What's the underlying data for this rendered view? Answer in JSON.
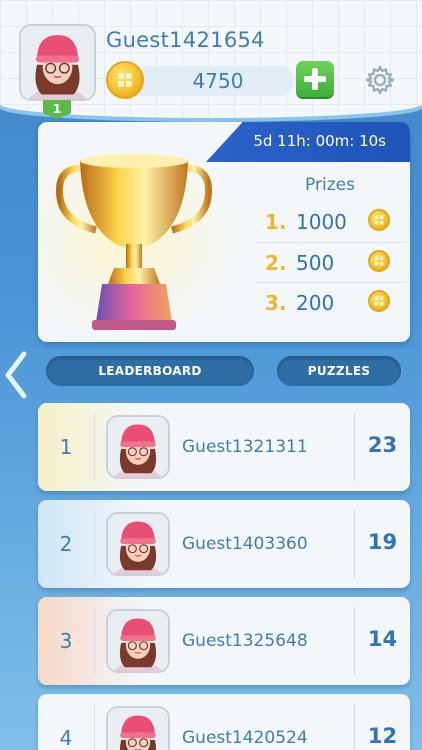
{
  "header": {
    "username": "Guest1421654",
    "level": "1",
    "coins": "4750"
  },
  "tournament": {
    "timer": "5d 11h: 00m: 10s",
    "prizes_title": "Prizes",
    "prizes": [
      {
        "rank": "1.",
        "value": "1000"
      },
      {
        "rank": "2.",
        "value": "500"
      },
      {
        "rank": "3.",
        "value": "200"
      }
    ]
  },
  "tabs": {
    "leaderboard": "LEADERBOARD",
    "puzzles": "PUZZLES"
  },
  "leaderboard": [
    {
      "rank": "1",
      "name": "Guest1321311",
      "score": "23",
      "tint": "#f5f0c8"
    },
    {
      "rank": "2",
      "name": "Guest1403360",
      "score": "19",
      "tint": "#cfe7f7"
    },
    {
      "rank": "3",
      "name": "Guest1325648",
      "score": "14",
      "tint": "#f6d8c9"
    },
    {
      "rank": "4",
      "name": "Guest1420524",
      "score": "12",
      "tint": "#f4f7fa"
    }
  ],
  "colors": {
    "accent_blue": "#3d7fb5",
    "timer_banner": "#2a63c9",
    "add_green": "#3fae39",
    "coin_gold": "#f4c22d"
  },
  "icons": {
    "coin": "coin-icon",
    "add": "plus-icon",
    "settings": "gear-icon",
    "back": "chevron-left-icon",
    "trophy": "trophy-icon"
  }
}
